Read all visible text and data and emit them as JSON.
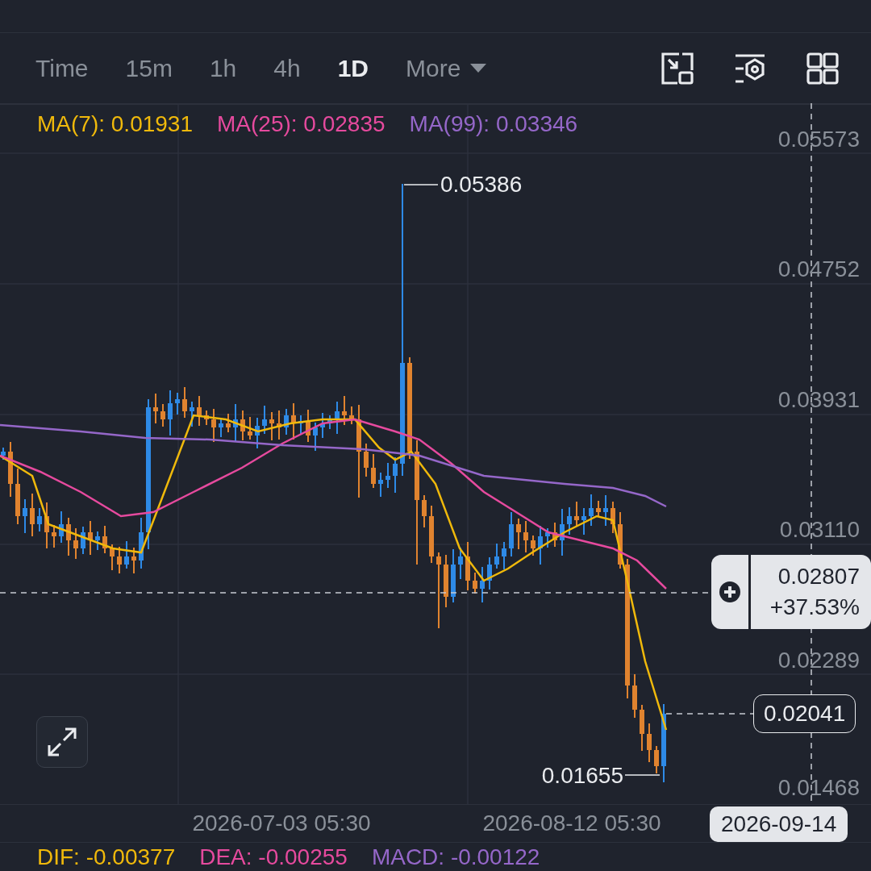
{
  "toolbar": {
    "intervals": [
      {
        "label": "Time",
        "selected": false,
        "kind": "tab"
      },
      {
        "label": "15m",
        "selected": false,
        "kind": "tab"
      },
      {
        "label": "1h",
        "selected": false,
        "kind": "tab"
      },
      {
        "label": "4h",
        "selected": false,
        "kind": "tab"
      },
      {
        "label": "1D",
        "selected": true,
        "kind": "tab"
      },
      {
        "label": "More",
        "selected": false,
        "kind": "dropdown"
      }
    ]
  },
  "moving_averages": [
    {
      "label": "MA(7): 0.01931",
      "color": "#f0b90b"
    },
    {
      "label": "MA(25): 0.02835",
      "color": "#e64a9e"
    },
    {
      "label": "MA(99): 0.03346",
      "color": "#9567c9"
    }
  ],
  "price_axis": [
    "0.05573",
    "0.04752",
    "0.03931",
    "0.03110",
    "0.02289",
    "0.01468"
  ],
  "annotations": {
    "high": "0.05386",
    "low": "0.01655"
  },
  "crosshair": {
    "price": "0.02807",
    "change": "+37.53%",
    "date": "2026-09-14"
  },
  "last_price": "0.02041",
  "time_axis": [
    "2026-07-03 05:30",
    "2026-08-12 05:30"
  ],
  "macd_legend": [
    {
      "label": "DIF: -0.00377",
      "color": "#f0b90b"
    },
    {
      "label": "DEA: -0.00255",
      "color": "#e64a9e"
    },
    {
      "label": "MACD: -0.00122",
      "color": "#9567c9"
    }
  ]
}
